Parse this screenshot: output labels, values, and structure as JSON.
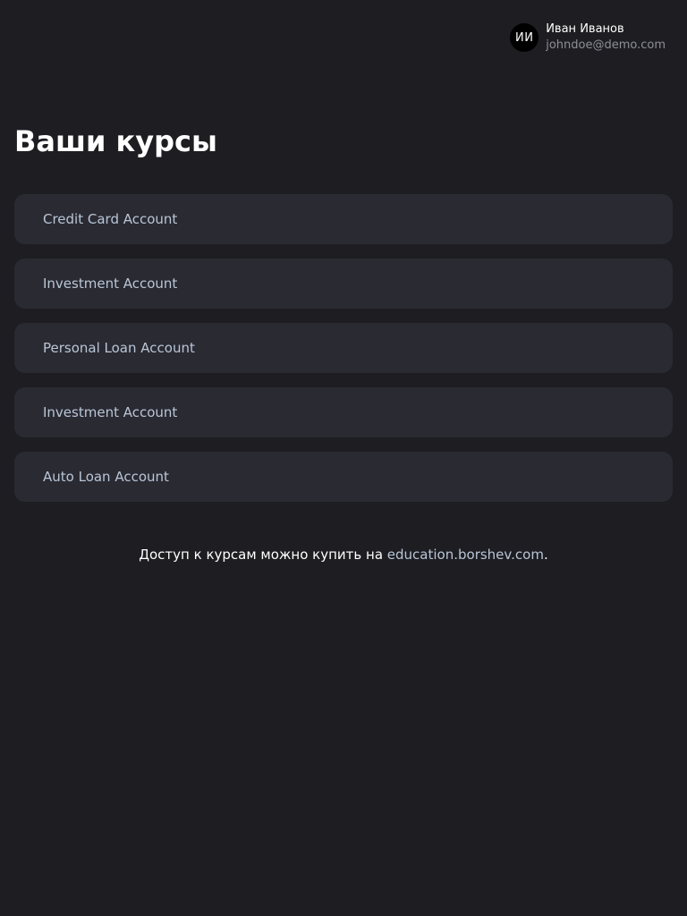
{
  "user": {
    "initials": "ИИ",
    "name": "Иван Иванов",
    "email": "johndoe@demo.com"
  },
  "page": {
    "title": "Ваши курсы"
  },
  "courses": [
    {
      "label": "Credit Card Account"
    },
    {
      "label": "Investment Account"
    },
    {
      "label": "Personal Loan Account"
    },
    {
      "label": "Investment Account"
    },
    {
      "label": "Auto Loan Account"
    }
  ],
  "footer": {
    "text": "Доступ к курсам можно купить на ",
    "link_text": "education.borshev.com",
    "suffix": "."
  },
  "colors": {
    "background": "#1d1d22",
    "card": "#2a2a33",
    "accent_text": "#b9c6d6",
    "muted_text": "#8e8e98"
  }
}
